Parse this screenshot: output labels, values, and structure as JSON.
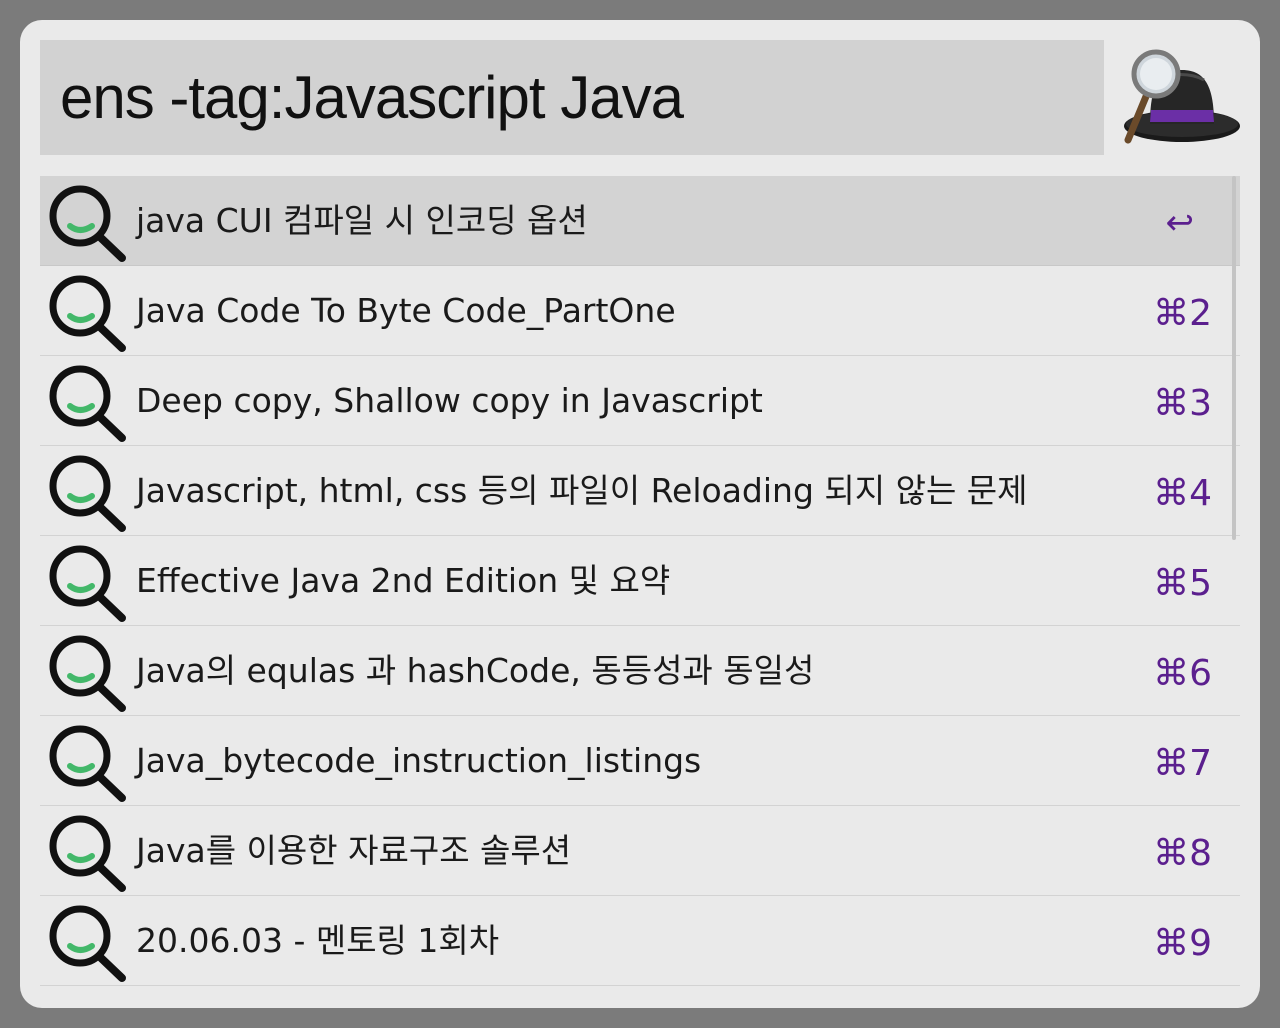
{
  "search": {
    "query": "ens -tag:Javascript Java"
  },
  "logo": {
    "icon": "alfred-hat-icon"
  },
  "results": [
    {
      "title": "java CUI 컴파일 시 인코딩 옵션",
      "shortcut": "↩",
      "selected": true
    },
    {
      "title": "Java Code To Byte Code_PartOne",
      "shortcut": "⌘2"
    },
    {
      "title": "Deep copy, Shallow copy in Javascript",
      "shortcut": "⌘3"
    },
    {
      "title": "Javascript, html, css 등의 파일이 Reloading 되지 않는 문제",
      "shortcut": "⌘4"
    },
    {
      "title": "Effective Java 2nd Edition 및 요약",
      "shortcut": "⌘5"
    },
    {
      "title": "Java의 equlas 과 hashCode, 동등성과 동일성",
      "shortcut": "⌘6"
    },
    {
      "title": "Java_bytecode_instruction_listings",
      "shortcut": "⌘7"
    },
    {
      "title": "Java를 이용한 자료구조 솔루션",
      "shortcut": "⌘8"
    },
    {
      "title": "20.06.03 - 멘토링 1회차",
      "shortcut": "⌘9"
    }
  ],
  "colors": {
    "shortcut": "#5b1f8e",
    "icon_accent": "#43b86a",
    "selection": "#d3d3d3"
  },
  "result_icon": "search-magnifier-icon"
}
